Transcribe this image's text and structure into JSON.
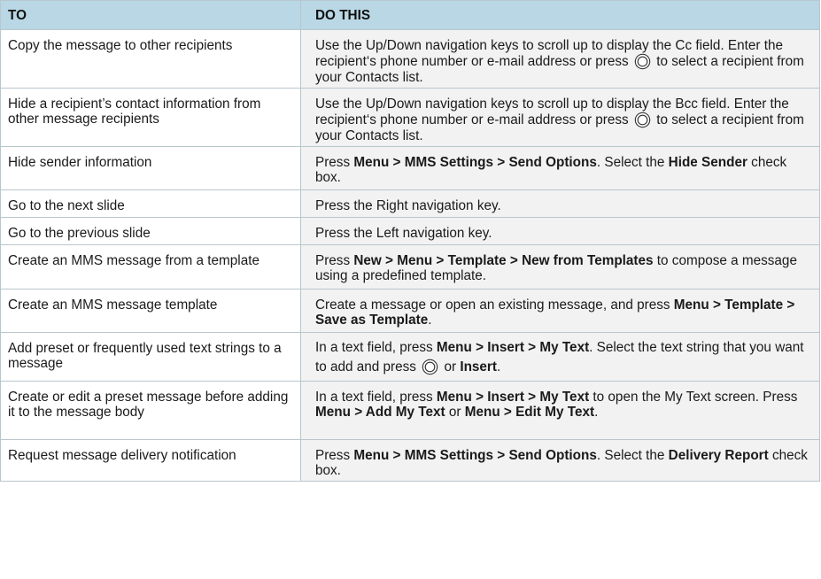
{
  "header": {
    "to": "TO",
    "do_this": "DO THIS"
  },
  "icons": {
    "nav": "navigation-center-key-icon"
  },
  "rows": [
    {
      "to": "Copy the message to other recipients",
      "do": [
        "Use the Up/Down navigation keys to scroll up to display the Cc field. Enter the recipient‘s phone number or e-mail address or press ",
        " to select a recipient from your Contacts list."
      ]
    },
    {
      "to": "Hide a recipient’s contact information from other message recipients",
      "do": [
        "Use the Up/Down navigation keys to scroll up to display the Bcc field. Enter the recipient‘s phone number or e-mail address or press ",
        " to select a recipient from your Contacts list."
      ]
    },
    {
      "to": "Hide sender information",
      "do": [
        "Press ",
        "Menu > MMS Settings > Send Options",
        ". Select the ",
        "Hide Sender",
        " check box."
      ]
    },
    {
      "to": "Go to the next slide",
      "do": [
        "Press the Right navigation key."
      ]
    },
    {
      "to": "Go to the previous slide",
      "do": [
        "Press the Left navigation key."
      ]
    },
    {
      "to": "Create an MMS message from a template",
      "do": [
        "Press ",
        "New > Menu > Template > New from Templates",
        " to compose a message using a predefined template."
      ]
    },
    {
      "to": "Create an MMS message template",
      "do": [
        "Create a message or open an existing message, and press ",
        "Menu > Template > Save as Template",
        "."
      ]
    },
    {
      "to": "Add preset or frequently used text strings to a message",
      "do": [
        "In a text field, press ",
        "Menu > Insert > My Text",
        ". Select the text string that you want to add and press ",
        " or ",
        "Insert",
        "."
      ]
    },
    {
      "to": "Create or edit a preset message before adding it to the message body",
      "do": [
        "In a text field, press ",
        "Menu > Insert > My Text",
        " to open the My Text screen. Press ",
        "Menu > Add My Text",
        " or ",
        "Menu > Edit My Text",
        "."
      ]
    },
    {
      "to": "Request message delivery notification",
      "do": [
        "Press ",
        "Menu > MMS Settings > Send Options",
        ". Select the ",
        "Delivery Report",
        " check box."
      ]
    }
  ]
}
